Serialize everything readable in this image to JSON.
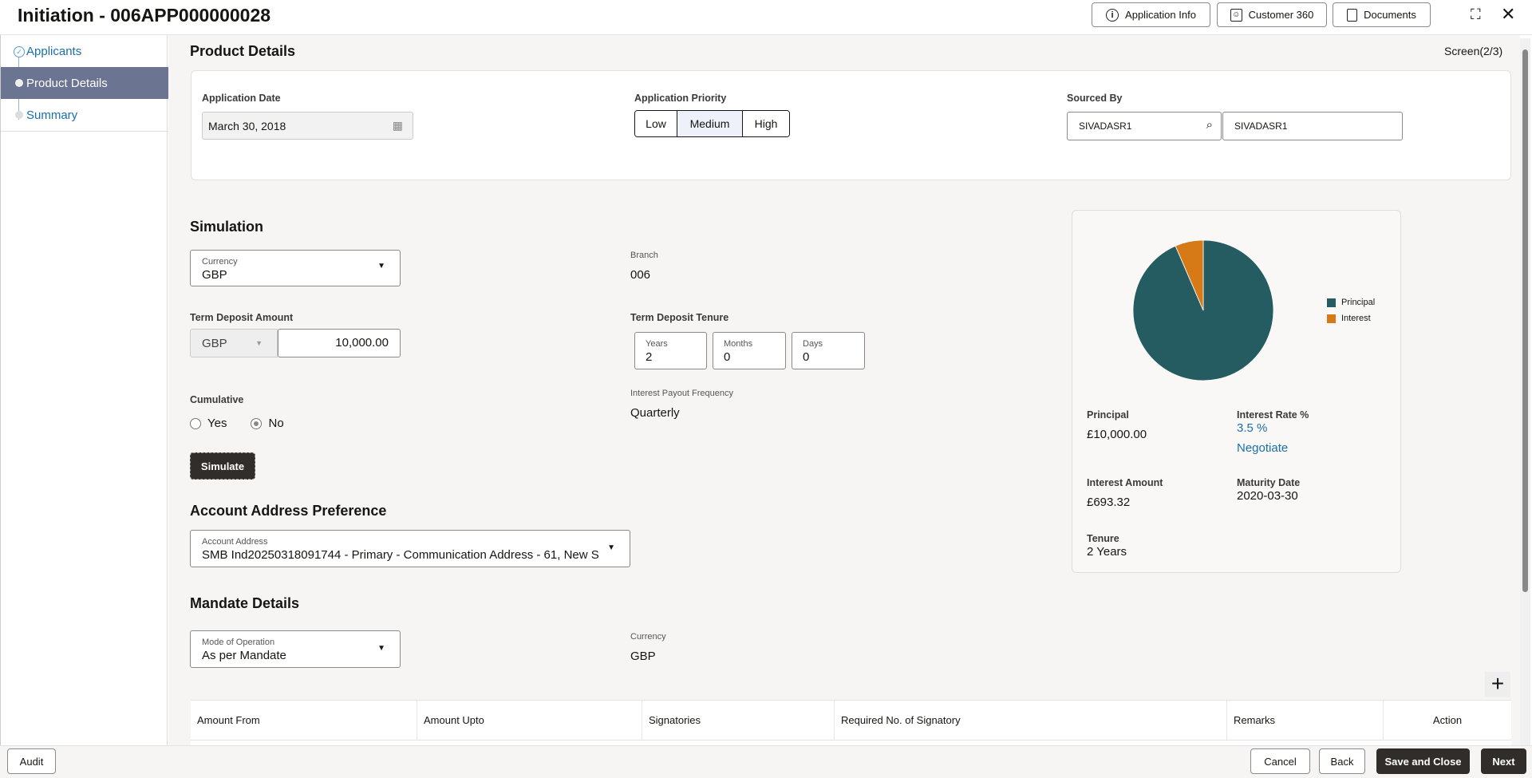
{
  "header": {
    "title": "Initiation - 006APP000000028",
    "application_info": "Application Info",
    "customer_360": "Customer 360",
    "documents": "Documents"
  },
  "sidebar": {
    "items": [
      {
        "label": "Applicants",
        "state": "completed"
      },
      {
        "label": "Product Details",
        "state": "active"
      },
      {
        "label": "Summary",
        "state": "pending"
      }
    ]
  },
  "page": {
    "title": "Product Details",
    "screen": "Screen(2/3)"
  },
  "product": {
    "application_date_label": "Application Date",
    "application_date": "March 30, 2018",
    "priority_label": "Application Priority",
    "priority_options": [
      "Low",
      "Medium",
      "High"
    ],
    "priority_selected": "Medium",
    "sourced_by_label": "Sourced By",
    "sourced_by_id": "SIVADASR1",
    "sourced_by_name": "SIVADASR1"
  },
  "simulation": {
    "title": "Simulation",
    "currency_label": "Currency",
    "currency": "GBP",
    "branch_label": "Branch",
    "branch": "006",
    "amount_label": "Term Deposit Amount",
    "amount_currency": "GBP",
    "amount": "10,000.00",
    "tenure_label": "Term Deposit Tenure",
    "years_label": "Years",
    "years": "2",
    "months_label": "Months",
    "months": "0",
    "days_label": "Days",
    "days": "0",
    "cumulative_label": "Cumulative",
    "yes": "Yes",
    "no": "No",
    "cumulative_selected": "No",
    "payout_label": "Interest Payout Frequency",
    "payout": "Quarterly",
    "simulate": "Simulate"
  },
  "summary_panel": {
    "principal_label": "Principal",
    "principal": "£10,000.00",
    "rate_label": "Interest Rate %",
    "rate": "3.5 %",
    "negotiate": "Negotiate",
    "interest_label": "Interest Amount",
    "interest": "£693.32",
    "maturity_label": "Maturity Date",
    "maturity": "2020-03-30",
    "tenure_label": "Tenure",
    "tenure": "2 Years"
  },
  "chart_data": {
    "type": "pie",
    "categories": [
      "Principal",
      "Interest"
    ],
    "values": [
      10000,
      693.32
    ],
    "colors": [
      "#255c62",
      "#d57a16"
    ],
    "legend": "right"
  },
  "address": {
    "title": "Account Address Preference",
    "label": "Account Address",
    "value": "SMB Ind20250318091744 - Primary - Communication Address - 61, New S"
  },
  "mandate": {
    "title": "Mandate Details",
    "mode_label": "Mode of Operation",
    "mode": "As per Mandate",
    "currency_label": "Currency",
    "currency": "GBP",
    "columns": [
      "Amount From",
      "Amount Upto",
      "Signatories",
      "Required No. of Signatory",
      "Remarks",
      "Action"
    ]
  },
  "footer": {
    "audit": "Audit",
    "cancel": "Cancel",
    "back": "Back",
    "save_close": "Save and Close",
    "next": "Next"
  }
}
